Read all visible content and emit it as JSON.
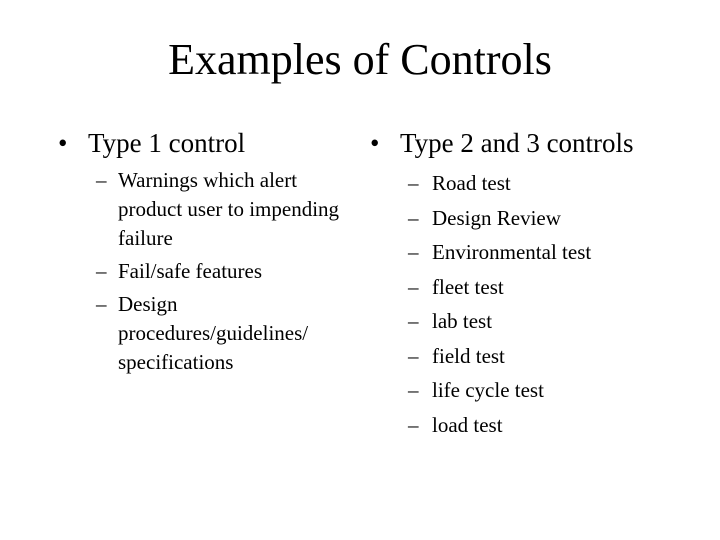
{
  "slide": {
    "title": "Examples of Controls",
    "left_column": {
      "bullet_glyph": "•",
      "heading": "Type 1 control",
      "dash_glyph": "–",
      "items": [
        "Warnings which alert product user to impending failure",
        "Fail/safe features",
        "Design procedures/guidelines/ specifications"
      ]
    },
    "right_column": {
      "bullet_glyph": "•",
      "heading": "Type 2 and 3 controls",
      "dash_glyph": "–",
      "items": [
        "Road test",
        "Design Review",
        "Environmental test",
        "fleet test",
        "lab test",
        "field test",
        "life cycle test",
        "load test"
      ]
    }
  }
}
